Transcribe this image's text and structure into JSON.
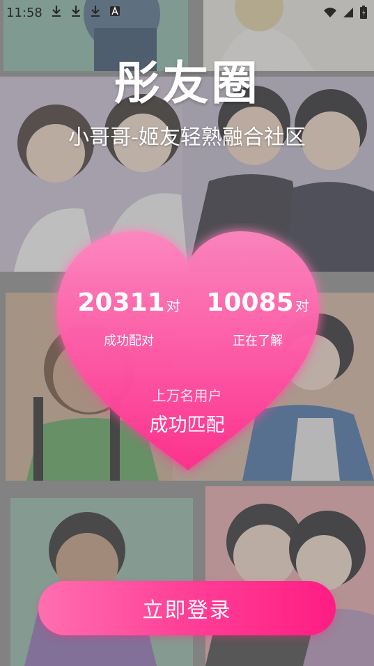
{
  "status_bar": {
    "time": "11:58",
    "download_icons": [
      "download-icon",
      "download-icon",
      "download-icon"
    ],
    "extra_icon": "a-icon",
    "right_icons": [
      "wifi-icon",
      "signal-icon",
      "battery-charging-icon"
    ]
  },
  "header": {
    "title": "彤友圈",
    "subtitle": "小哥哥-姬友轻熟融合社区"
  },
  "stats": {
    "left": {
      "value": "20311",
      "unit": "对",
      "label": "成功配对"
    },
    "right": {
      "value": "10085",
      "unit": "对",
      "label": "正在了解"
    }
  },
  "users": {
    "line1": "上万名用户",
    "line2": "成功匹配"
  },
  "login": {
    "label": "立即登录"
  },
  "colors": {
    "accent": "#ff2d8b",
    "heart_top": "#ff86c0",
    "heart_bottom": "#ff2e8e",
    "button_start": "#ff6fb0",
    "button_end": "#ff1d83"
  }
}
